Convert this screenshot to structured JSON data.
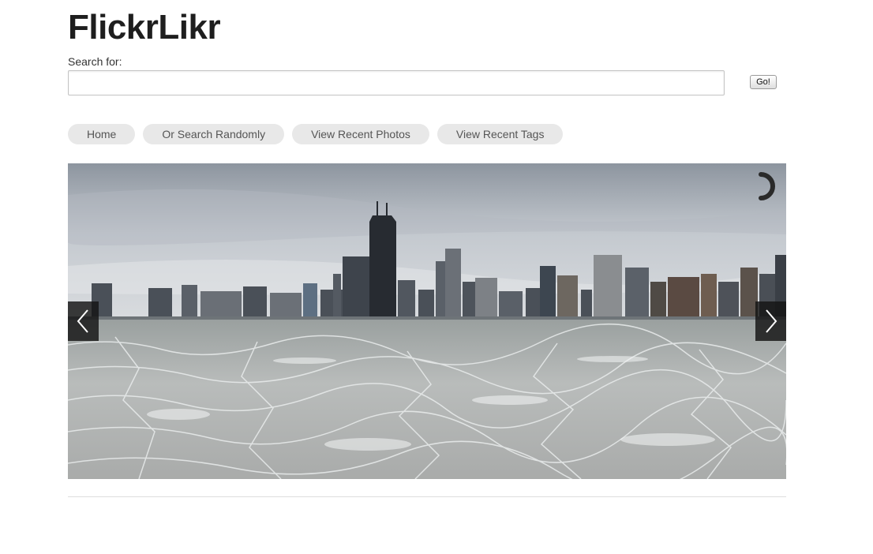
{
  "app": {
    "title": "FlickrLikr"
  },
  "search": {
    "label": "Search for:",
    "value": "",
    "placeholder": "",
    "go_label": "Go!"
  },
  "nav": {
    "items": [
      {
        "label": "Home"
      },
      {
        "label": "Or Search Randomly"
      },
      {
        "label": "View Recent Photos"
      },
      {
        "label": "View Recent Tags"
      }
    ]
  },
  "slideshow": {
    "photo_subject": "city skyline over frozen lake",
    "prev_icon": "chevron-left-icon",
    "next_icon": "chevron-right-icon",
    "loader_icon": "loading-spinner-icon"
  },
  "colors": {
    "title": "#1e1e1e",
    "nav_pill_bg": "#e8e8e8",
    "nav_pill_text": "#555555",
    "arrow_bg": "#141414"
  }
}
